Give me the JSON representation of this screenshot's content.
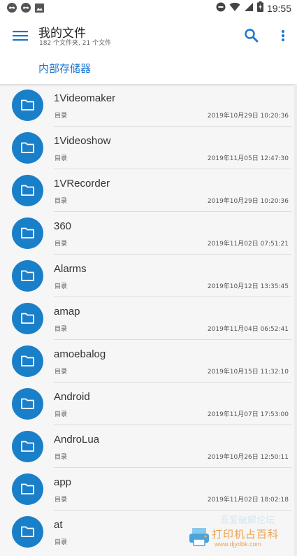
{
  "status_bar": {
    "time": "19:55"
  },
  "app_bar": {
    "title": "我的文件",
    "subtitle": "182 个文件夹, 21 个文件"
  },
  "breadcrumb": {
    "label": "内部存储器"
  },
  "items": [
    {
      "name": "1Videomaker",
      "type": "目录",
      "date": "2019年10月29日 10:20:36"
    },
    {
      "name": "1Videoshow",
      "type": "目录",
      "date": "2019年11月05日 12:47:30"
    },
    {
      "name": "1VRecorder",
      "type": "目录",
      "date": "2019年10月29日 10:20:36"
    },
    {
      "name": "360",
      "type": "目录",
      "date": "2019年11月02日 07:51:21"
    },
    {
      "name": "Alarms",
      "type": "目录",
      "date": "2019年10月12日 13:35:45"
    },
    {
      "name": "amap",
      "type": "目录",
      "date": "2019年11月04日 06:52:41"
    },
    {
      "name": "amoebalog",
      "type": "目录",
      "date": "2019年10月15日 11:32:10"
    },
    {
      "name": "Android",
      "type": "目录",
      "date": "2019年11月07日 17:53:00"
    },
    {
      "name": "AndroLua",
      "type": "目录",
      "date": "2019年10月26日 12:50:11"
    },
    {
      "name": "app",
      "type": "目录",
      "date": "2019年11月02日 18:02:18"
    },
    {
      "name": "at",
      "type": "目录",
      "date": ""
    }
  ],
  "watermark": {
    "text": "打印机占百科",
    "url": "www.djydbk.com",
    "faint_text": "吾爱破解论坛"
  },
  "colors": {
    "accent": "#1976d2",
    "folder": "#1a7fc9",
    "list_bg": "#f6f6f6"
  }
}
